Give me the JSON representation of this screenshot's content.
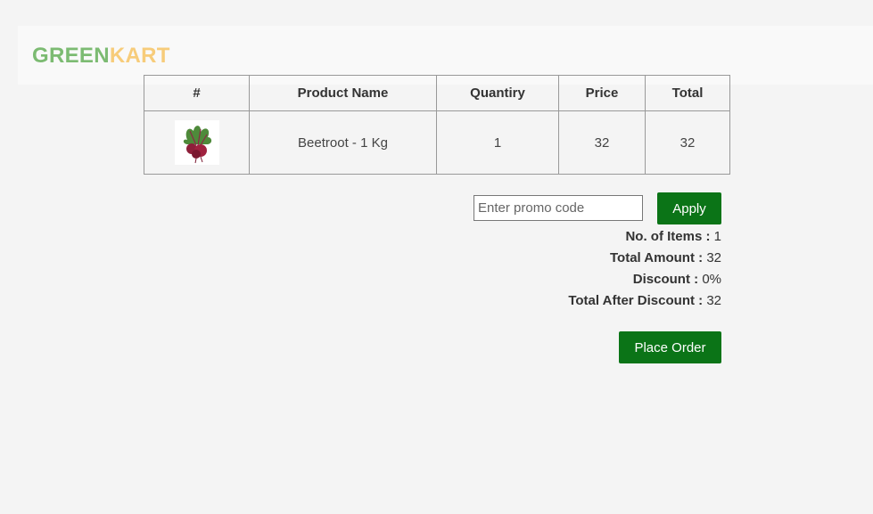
{
  "logo": {
    "part1": "GREEN",
    "part2": "KART"
  },
  "table": {
    "headers": [
      "#",
      "Product Name",
      "Quantiry",
      "Price",
      "Total"
    ],
    "rows": [
      {
        "product": "Beetroot - 1 Kg",
        "quantity": "1",
        "price": "32",
        "total": "32",
        "image_icon": "beetroot-image"
      }
    ]
  },
  "promo": {
    "placeholder": "Enter promo code",
    "apply_label": "Apply"
  },
  "summary": {
    "items_label": "No. of Items :",
    "items_value": "1",
    "amount_label": "Total Amount :",
    "amount_value": "32",
    "discount_label": "Discount :",
    "discount_value": "0%",
    "after_label": "Total After Discount :",
    "after_value": "32"
  },
  "order": {
    "label": "Place Order"
  },
  "colors": {
    "brand_green": "#7cbb72",
    "brand_yellow": "#f7cc7a",
    "button": "#0b7417"
  }
}
